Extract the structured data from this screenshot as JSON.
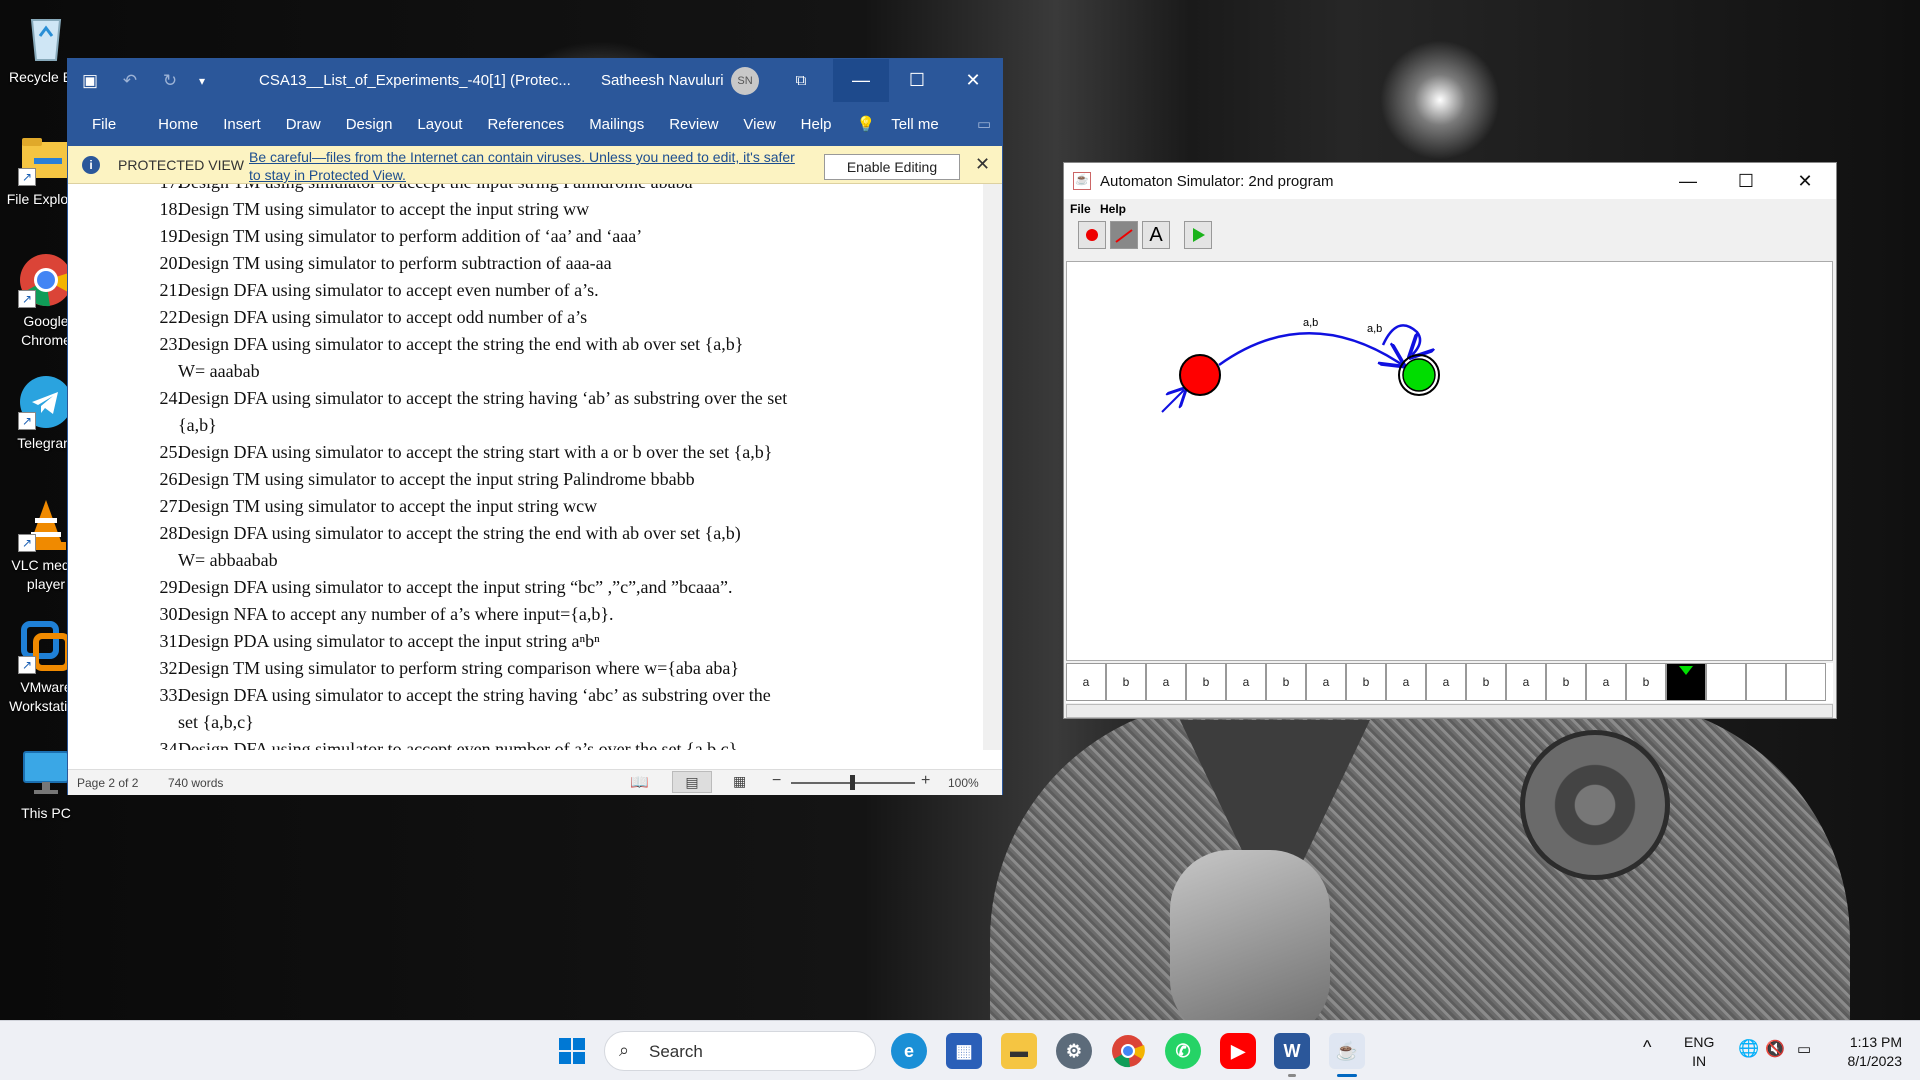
{
  "desktop": {
    "icons": [
      {
        "label": "Recycle Bin",
        "name": "recycle-bin-icon"
      },
      {
        "label": "File Explorer",
        "name": "file-explorer-icon"
      },
      {
        "label": "Google Chrome",
        "name": "chrome-icon"
      },
      {
        "label": "Telegram",
        "name": "telegram-icon"
      },
      {
        "label": "VLC media player",
        "name": "vlc-icon"
      },
      {
        "label": "VMware Workstation",
        "name": "vmware-icon"
      },
      {
        "label": "This PC",
        "name": "this-pc-icon"
      }
    ]
  },
  "word": {
    "title": "CSA13__List_of_Experiments_-40[1] (Protec...",
    "user": "Satheesh Navuluri",
    "user_initials": "SN",
    "tabs": [
      "File",
      "Home",
      "Insert",
      "Draw",
      "Design",
      "Layout",
      "References",
      "Mailings",
      "Review",
      "View",
      "Help",
      "Tell me"
    ],
    "protected": {
      "label": "PROTECTED VIEW",
      "message": "Be careful—files from the Internet can contain viruses. Unless you need to edit, it's safer to stay in Protected View.",
      "button": "Enable Editing"
    },
    "lines": [
      {
        "n": "17.",
        "t": "Design TM using simulator to accept the input string Palindrome  ababa"
      },
      {
        "n": "18.",
        "t": "Design TM using simulator to accept the input string  ww"
      },
      {
        "n": "19.",
        "t": "Design TM using simulator to perform addition of ‘aa’ and ‘aaa’"
      },
      {
        "n": "20.",
        "t": "Design TM using simulator to perform subtraction of aaa-aa"
      },
      {
        "n": "21.",
        "t": "Design DFA  using simulator to  accept even number of a’s."
      },
      {
        "n": "22.",
        "t": "Design DFA using simulator to accept odd number of a’s"
      },
      {
        "n": "23.",
        "t": "Design DFA using simulator to accept the string the end with ab over set {a,b}"
      },
      {
        "n": "",
        "t": "  W=  aaabab"
      },
      {
        "n": "24.",
        "t": "Design DFA using simulator to accept the string having ‘ab’ as substring over the set"
      },
      {
        "n": "",
        "t": "{a,b}"
      },
      {
        "n": "25.",
        "t": "Design DFA using simulator to accept the string start with a or b over the set {a,b}"
      },
      {
        "n": "26.",
        "t": "Design TM using simulator to accept the input string Palindrome  bbabb"
      },
      {
        "n": "27.",
        "t": "Design TM using simulator to accept the input string  wcw"
      },
      {
        "n": "28.",
        "t": "Design DFA using simulator to accept the string the end with ab over set {a,b)"
      },
      {
        "n": "",
        "t": "  W=  abbaabab"
      },
      {
        "n": "29.",
        "t": "Design DFA  using simulator to accept the input string “bc” ,”c”,and ”bcaaa”."
      },
      {
        "n": "30.",
        "t": "Design NFA to accept any number of a’s where input={a,b}."
      },
      {
        "n": "31.",
        "t": "Design PDA using simulator to accept the input string  aⁿbⁿ"
      },
      {
        "n": "32.",
        "t": "Design TM using simulator to perform string comparison where w={aba aba}"
      },
      {
        "n": "33.",
        "t": "Design DFA using simulator to accept the string having ‘abc’ as substring over the"
      },
      {
        "n": "",
        "t": "set {a,b,c}"
      },
      {
        "n": "34.",
        "t": "Design DFA using simulator to accept even number of a’s over the set {a,b,c}"
      }
    ],
    "status": {
      "page": "Page 2 of 2",
      "words": "740 words",
      "zoom": "100%"
    }
  },
  "simulator": {
    "title": "Automaton Simulator: 2nd program",
    "menu": [
      "File",
      "Help"
    ],
    "transition_labels": [
      "a,b",
      "a,b"
    ],
    "tape": [
      "a",
      "b",
      "a",
      "b",
      "a",
      "b",
      "a",
      "b",
      "a",
      "a",
      "b",
      "a",
      "b",
      "a",
      "b",
      "",
      "",
      "",
      ""
    ],
    "head_index": 15,
    "colors": {
      "start_state": "#ff0000",
      "accept_state": "#00dd00",
      "edge": "#1010e0"
    }
  },
  "taskbar": {
    "search": "Search",
    "apps": [
      "windows-start-icon",
      "edge-icon",
      "store-icon",
      "file-explorer-icon",
      "settings-icon",
      "chrome-icon",
      "whatsapp-icon",
      "youtube-icon",
      "word-icon",
      "java-icon"
    ],
    "lang1": "ENG",
    "lang2": "IN",
    "time": "1:13 PM",
    "date": "8/1/2023"
  }
}
